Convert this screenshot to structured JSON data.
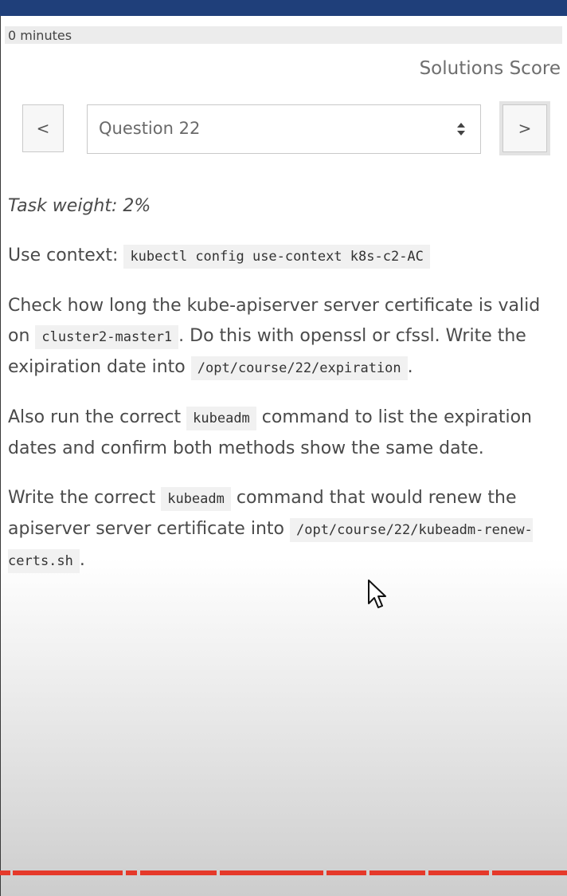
{
  "timer": {
    "text": "0 minutes"
  },
  "top_links": {
    "solutions": "Solutions",
    "score": "Score"
  },
  "navigation": {
    "prev_label": "<",
    "next_label": ">",
    "selected_question": "Question 22"
  },
  "task": {
    "weight": "Task weight: 2%",
    "p1": {
      "text": "Use context:",
      "code": "kubectl config use-context k8s-c2-AC"
    },
    "p2": {
      "t1": "Check how long the kube-apiserver server certificate is valid on",
      "c1": "cluster2-master1",
      "t2": ". Do this with openssl or cfssl. Write the exipiration date into",
      "c2": "/opt/course/22/expiration",
      "t3": "."
    },
    "p3": {
      "t1": "Also run the correct",
      "c1": "kubeadm",
      "t2": "command to list the expiration dates and confirm both methods show the same date."
    },
    "p4": {
      "t1": "Write the correct",
      "c1": "kubeadm",
      "t2": "command that would renew the apiserver server certificate into",
      "c2": "/opt/course/22/kubeadm-renew-certs.sh",
      "t3": "."
    }
  },
  "icons": {
    "select_indicator": "sort-updown-icon",
    "pointer": "mouse-cursor-icon"
  },
  "colors": {
    "top_bar": "#1f3f7a",
    "progress_strip": "#e5392a"
  }
}
